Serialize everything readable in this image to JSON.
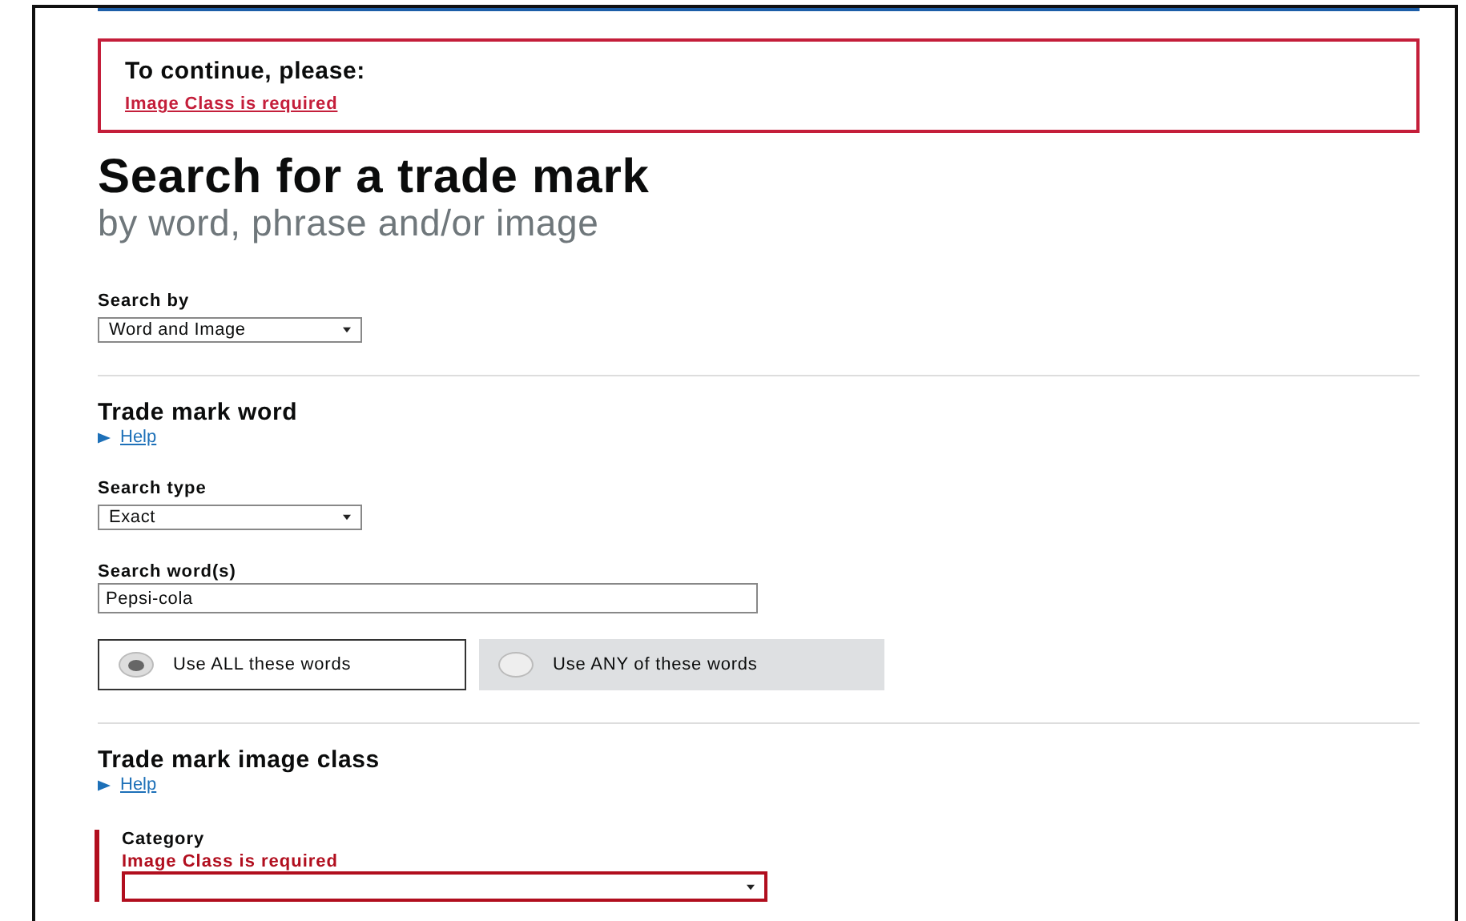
{
  "error_summary": {
    "heading": "To continue, please:",
    "links": [
      "Image Class is required"
    ]
  },
  "title": "Search for a trade mark",
  "subtitle": "by word, phrase and/or image",
  "search_by": {
    "label": "Search by",
    "value": "Word and Image"
  },
  "word_section": {
    "heading": "Trade mark word",
    "help": "Help",
    "search_type": {
      "label": "Search type",
      "value": "Exact"
    },
    "search_words": {
      "label": "Search word(s)",
      "value": "Pepsi-cola"
    },
    "options": [
      {
        "label": "Use ALL these words",
        "selected": true
      },
      {
        "label": "Use ANY of these words",
        "selected": false
      }
    ]
  },
  "image_section": {
    "heading": "Trade mark image class",
    "help": "Help",
    "category": {
      "label": "Category",
      "error": "Image Class is required"
    }
  }
}
